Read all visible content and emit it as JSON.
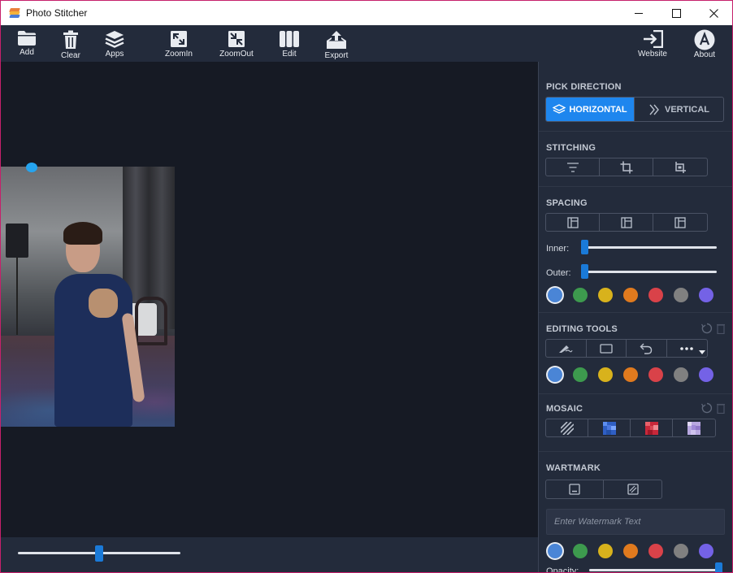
{
  "window": {
    "title": "Photo Stitcher"
  },
  "toolbar": {
    "add_label": "Add",
    "clear_label": "Clear",
    "apps_label": "Apps",
    "zoomin_label": "ZoomIn",
    "zoomout_label": "ZoomOut",
    "edit_label": "Edit",
    "export_label": "Export",
    "website_label": "Website",
    "about_label": "About"
  },
  "canvas": {
    "zoom_level": 0.5
  },
  "panel": {
    "pick_direction": {
      "title": "PICK DIRECTION",
      "options": [
        "HORIZONTAL",
        "VERTICAL"
      ],
      "selected": "HORIZONTAL"
    },
    "stitching": {
      "title": "STITCHING",
      "options": [
        "center-align-icon",
        "crop-icon",
        "crop-bottom-icon"
      ]
    },
    "spacing": {
      "title": "SPACING",
      "options": [
        "layout-left-icon",
        "layout-center-icon",
        "layout-right-icon"
      ],
      "inner_label": "Inner:",
      "outer_label": "Outer:",
      "inner_value": 0,
      "outer_value": 0,
      "colors": [
        "#4a85d6",
        "#3d9a4e",
        "#d8b21c",
        "#e07a1e",
        "#d94249",
        "#808080",
        "#7462e6"
      ],
      "selected_color": "#4a85d6"
    },
    "editing_tools": {
      "title": "EDITING TOOLS",
      "options": [
        "brush-icon",
        "rectangle-icon",
        "undo-icon",
        "more-icon"
      ],
      "colors": [
        "#4a85d6",
        "#3d9a4e",
        "#d8b21c",
        "#e07a1e",
        "#d94249",
        "#808080",
        "#7462e6"
      ],
      "selected_color": "#4a85d6"
    },
    "mosaic": {
      "title": "MOSAIC",
      "options": [
        "hatch-pattern-icon",
        "blue-mosaic-icon",
        "red-mosaic-icon",
        "purple-mosaic-icon"
      ]
    },
    "watermark": {
      "title": "WARTMARK",
      "options": [
        "text-watermark-icon",
        "pattern-watermark-icon"
      ],
      "placeholder": "Enter Watermark Text",
      "colors": [
        "#4a85d6",
        "#3d9a4e",
        "#d8b21c",
        "#e07a1e",
        "#d94249",
        "#808080",
        "#7462e6"
      ],
      "selected_color": "#4a85d6",
      "opacity_label": "Opacity:",
      "opacity_value": 1.0
    }
  }
}
